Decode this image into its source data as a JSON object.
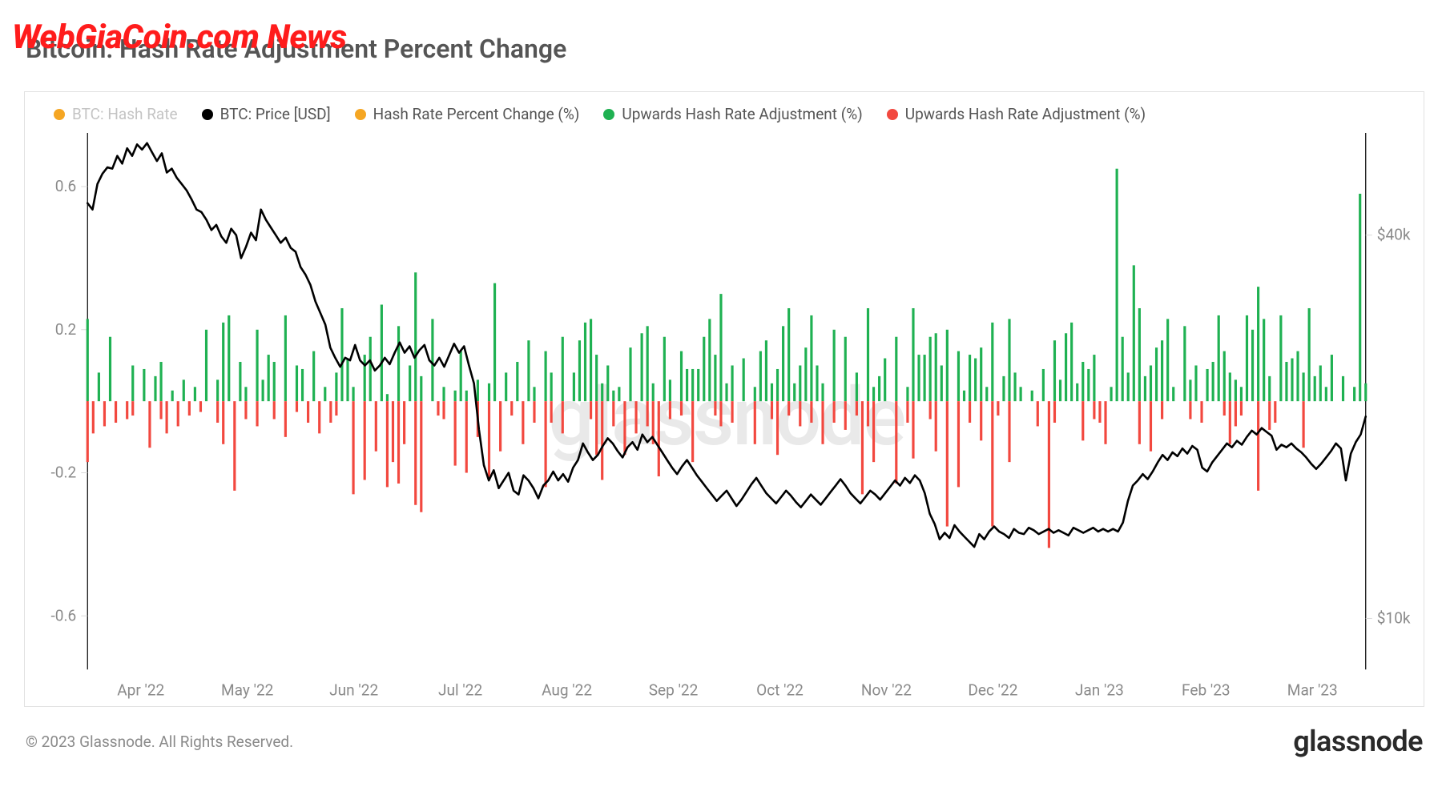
{
  "overlay_text": "WebGiaCoin.com News",
  "title": "Bitcoin: Hash Rate Adjustment Percent Change",
  "legend": [
    {
      "label": "BTC: Hash Rate",
      "color": "#f5a623"
    },
    {
      "label": "BTC: Price [USD]",
      "color": "#000000"
    },
    {
      "label": "Hash Rate Percent Change (%)",
      "color": "#f5a623"
    },
    {
      "label": "Upwards Hash Rate Adjustment (%)",
      "color": "#1fb152"
    },
    {
      "label": "Upwards Hash Rate Adjustment (%)",
      "color": "#f2483f"
    }
  ],
  "copyright": "© 2023 Glassnode. All Rights Reserved.",
  "brand": "glassnode",
  "watermark": "glassnode",
  "chart_data": {
    "type": "bar+line",
    "x_label": "",
    "x_categories": [
      "Apr '22",
      "May '22",
      "Jun '22",
      "Jul '22",
      "Aug '22",
      "Sep '22",
      "Oct '22",
      "Nov '22",
      "Dec '22",
      "Jan '23",
      "Feb '23",
      "Mar '23"
    ],
    "left_axis": {
      "label": "",
      "ticks": [
        -0.6,
        -0.2,
        0.2,
        0.6
      ],
      "range": [
        -0.75,
        0.75
      ]
    },
    "right_axis": {
      "label": "",
      "ticks": [
        "$10k",
        "$40k"
      ],
      "tick_values": [
        10000,
        40000
      ],
      "range": [
        6000,
        48000
      ],
      "scale": "linear"
    },
    "series": [
      {
        "name": "Upwards Hash Rate Adjustment (%)",
        "kind": "bar",
        "axis": "left",
        "color": "#1fb152",
        "values": [
          0.23,
          0,
          0.08,
          0,
          0.18,
          0,
          0,
          0,
          0.1,
          0,
          0.09,
          0,
          0.07,
          0.11,
          0,
          0.03,
          0,
          0.06,
          0,
          0.04,
          0,
          0.2,
          0,
          0.06,
          0.22,
          0.24,
          0,
          0.11,
          0.04,
          0,
          0.2,
          0.06,
          0.13,
          0.11,
          0,
          0.24,
          0,
          0.1,
          0.09,
          0,
          0.14,
          0,
          0.04,
          0,
          0.08,
          0.26,
          0.12,
          0.04,
          0,
          0.13,
          0.18,
          0,
          0.27,
          0.02,
          0,
          0.21,
          0,
          0.1,
          0.36,
          0.07,
          0,
          0.23,
          0,
          0.04,
          0,
          0.03,
          0.14,
          0.03,
          0,
          0.06,
          0,
          0.05,
          0.33,
          0,
          0.08,
          0,
          0.11,
          0,
          0.17,
          0.04,
          0,
          0.14,
          0.08,
          0,
          0.18,
          0,
          0.08,
          0.17,
          0.22,
          0.23,
          0.13,
          0.05,
          0.1,
          0.03,
          0.04,
          0,
          0.15,
          0,
          0.19,
          0.21,
          0.05,
          0,
          0.18,
          0.06,
          0,
          0.14,
          0.09,
          0.09,
          0.09,
          0.18,
          0.23,
          0.13,
          0.3,
          0.05,
          0.1,
          0,
          0.12,
          0,
          0.04,
          0.14,
          0.17,
          0.05,
          0.09,
          0.21,
          0.26,
          0.05,
          0.1,
          0.15,
          0.24,
          0.1,
          0.05,
          0,
          0.2,
          0,
          0.18,
          0,
          0.08,
          0,
          0.26,
          0.04,
          0.07,
          0.12,
          0,
          0.18,
          0,
          0.04,
          0.26,
          0.13,
          0.13,
          0.18,
          0.19,
          0.1,
          0.2,
          0,
          0.14,
          0.03,
          0.13,
          0.12,
          0.15,
          0.04,
          0.22,
          0,
          0.07,
          0.23,
          0.08,
          0.04,
          0,
          0.03,
          0,
          0.09,
          0,
          0.17,
          0.06,
          0.19,
          0.22,
          0.05,
          0.11,
          0.09,
          0.13,
          0,
          0,
          0.04,
          0.65,
          0.18,
          0.08,
          0.38,
          0.26,
          0.07,
          0.1,
          0.15,
          0.17,
          0.23,
          0.04,
          0,
          0.21,
          0.06,
          0.1,
          0,
          0.09,
          0.11,
          0.24,
          0.14,
          0.08,
          0.06,
          0.04,
          0.24,
          0.2,
          0.32,
          0.23,
          0.07,
          0,
          0.24,
          0.11,
          0.12,
          0.14,
          0.08,
          0.26,
          0.07,
          0.1,
          0.04,
          0.13,
          0,
          0.07,
          0,
          0.04,
          0.58,
          0.05
        ]
      },
      {
        "name": "Upwards Hash Rate Adjustment (%)",
        "kind": "bar",
        "axis": "left",
        "color": "#f2483f",
        "values": [
          -0.17,
          -0.09,
          0,
          -0.07,
          0,
          -0.06,
          0,
          -0.05,
          -0.04,
          0,
          0,
          -0.13,
          0,
          -0.05,
          -0.09,
          0,
          -0.07,
          0,
          -0.04,
          0,
          -0.03,
          0,
          0,
          -0.06,
          -0.12,
          0,
          -0.25,
          0,
          -0.05,
          0,
          -0.07,
          0,
          0,
          -0.05,
          0,
          -0.1,
          0,
          -0.03,
          0,
          -0.06,
          0,
          -0.09,
          0,
          -0.06,
          -0.04,
          0,
          0,
          -0.26,
          0,
          -0.22,
          0,
          -0.14,
          0,
          -0.24,
          -0.17,
          -0.23,
          -0.12,
          0,
          -0.29,
          -0.31,
          0,
          0,
          -0.04,
          -0.05,
          0,
          -0.18,
          0,
          -0.2,
          0,
          -0.1,
          0,
          -0.22,
          0,
          -0.14,
          0,
          -0.04,
          0,
          -0.12,
          0,
          -0.06,
          0,
          -0.24,
          -0.06,
          0,
          -0.09,
          0,
          0,
          0,
          0,
          -0.05,
          -0.15,
          -0.22,
          0,
          -0.07,
          0,
          -0.15,
          0,
          -0.09,
          0,
          -0.07,
          -0.12,
          -0.21,
          0,
          -0.05,
          0,
          -0.04,
          0,
          -0.17,
          0,
          0,
          0,
          -0.04,
          -0.07,
          0,
          -0.06,
          0,
          0,
          0,
          -0.12,
          0,
          0,
          -0.05,
          -0.15,
          0,
          -0.04,
          0,
          -0.07,
          0,
          -0.06,
          0,
          -0.12,
          0,
          -0.06,
          0,
          -0.08,
          0,
          -0.04,
          -0.26,
          -0.07,
          -0.17,
          0,
          0,
          0,
          -0.23,
          0,
          -0.06,
          -0.16,
          0,
          0,
          -0.05,
          -0.14,
          0,
          -0.35,
          0,
          -0.24,
          0,
          -0.06,
          0,
          -0.11,
          0,
          -0.35,
          -0.04,
          0,
          -0.17,
          0,
          0,
          0,
          0,
          -0.07,
          0,
          -0.41,
          -0.06,
          0,
          0,
          0,
          0,
          -0.11,
          0,
          -0.05,
          -0.06,
          -0.12,
          0,
          0,
          0,
          0,
          0,
          -0.12,
          0,
          -0.14,
          0,
          -0.05,
          0,
          0,
          0,
          0,
          -0.05,
          0,
          -0.06,
          0,
          0,
          0,
          -0.04,
          -0.12,
          -0.07,
          -0.04,
          0,
          0,
          -0.25,
          0,
          -0.08,
          -0.06,
          0,
          0,
          0,
          0,
          -0.13,
          0
        ]
      },
      {
        "name": "BTC: Price [USD]",
        "kind": "line",
        "axis": "right",
        "color": "#000000",
        "values": [
          42500,
          42000,
          44000,
          44800,
          45300,
          45200,
          46200,
          45600,
          46800,
          46200,
          47100,
          46700,
          47200,
          46500,
          45800,
          46400,
          44900,
          45200,
          44500,
          44000,
          43500,
          42800,
          42000,
          41800,
          41200,
          40400,
          40800,
          39900,
          39400,
          40500,
          40000,
          38200,
          39100,
          40200,
          39600,
          42000,
          41200,
          40600,
          40000,
          39400,
          39800,
          39000,
          38700,
          37500,
          36900,
          36100,
          34800,
          33900,
          33000,
          31200,
          30400,
          29700,
          30400,
          30200,
          31400,
          30200,
          29800,
          30200,
          29400,
          29800,
          30400,
          29900,
          30800,
          31600,
          30800,
          31300,
          30400,
          31000,
          31400,
          30200,
          29800,
          30400,
          29700,
          30600,
          31500,
          30800,
          31300,
          29800,
          28400,
          24800,
          22000,
          20800,
          21600,
          20200,
          20800,
          21400,
          20000,
          19700,
          21200,
          20800,
          20200,
          19400,
          20400,
          20800,
          21500,
          20800,
          21300,
          20700,
          21800,
          22400,
          23700,
          23000,
          22400,
          22800,
          23500,
          24100,
          23700,
          23100,
          22600,
          23400,
          23800,
          23200,
          24400,
          23800,
          24200,
          23600,
          23000,
          22400,
          21800,
          21300,
          21900,
          22400,
          21800,
          21200,
          20700,
          20200,
          19700,
          19200,
          19600,
          20000,
          19400,
          18800,
          19300,
          19900,
          20500,
          21000,
          20400,
          19800,
          19400,
          19000,
          19500,
          20000,
          19600,
          19100,
          18700,
          19200,
          19700,
          19300,
          18900,
          19400,
          19900,
          20400,
          20900,
          20400,
          19800,
          19400,
          19000,
          19500,
          20000,
          19700,
          19300,
          19800,
          20300,
          20800,
          20400,
          21000,
          20600,
          21200,
          20800,
          19800,
          18200,
          17400,
          16200,
          16700,
          16300,
          17300,
          16800,
          16400,
          16000,
          15600,
          16600,
          16200,
          16800,
          17200,
          16800,
          16600,
          16300,
          17000,
          16700,
          16600,
          17100,
          16900,
          16600,
          16800,
          17000,
          16700,
          16900,
          16700,
          16500,
          17100,
          16900,
          16700,
          16900,
          17100,
          16800,
          17000,
          16800,
          17000,
          16800,
          17500,
          19200,
          20400,
          20800,
          21300,
          20900,
          21500,
          22200,
          22800,
          22400,
          23000,
          22700,
          23300,
          22900,
          23500,
          23200,
          21800,
          21500,
          22200,
          22700,
          23200,
          23700,
          23400,
          23900,
          23600,
          24200,
          24700,
          24400,
          24900,
          24600,
          24300,
          23200,
          23600,
          23400,
          23700,
          23300,
          23000,
          22600,
          22100,
          21700,
          22100,
          22600,
          23100,
          23700,
          23300,
          20800,
          22900,
          23800,
          24400,
          25800
        ]
      }
    ]
  }
}
